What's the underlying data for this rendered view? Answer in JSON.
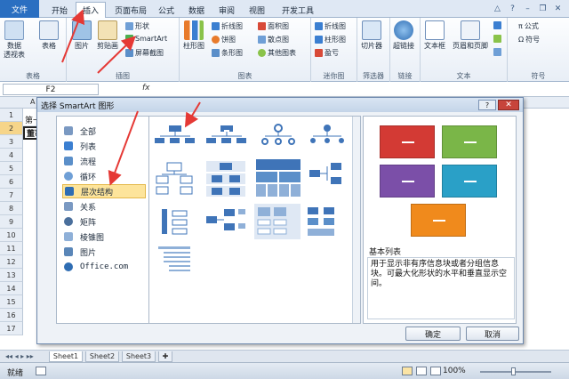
{
  "ribbon_tabs": {
    "file": "文件",
    "home": "开始",
    "insert": "插入",
    "page_layout": "页面布局",
    "formulas": "公式",
    "data": "数据",
    "review": "审阅",
    "view": "视图",
    "developer": "开发工具"
  },
  "ribbon": {
    "tables": {
      "pivot": "数据\n透视表",
      "table": "表格",
      "group": "表格"
    },
    "illustrations": {
      "picture": "图片",
      "clipart": "剪贴画",
      "shapes": "形状",
      "smartart": "SmartArt",
      "screenshot": "屏幕截图",
      "group": "插图"
    },
    "charts": {
      "column": "柱形图",
      "line": "折线图",
      "pie": "饼图",
      "bar": "条形图",
      "area": "面积图",
      "scatter": "散点图",
      "other": "其他图表",
      "group": "图表"
    },
    "sparklines": {
      "line": "折线图",
      "column": "柱形图",
      "winloss": "盈亏",
      "group": "迷你图"
    },
    "filter": {
      "slicer": "切片器",
      "group": "筛选器"
    },
    "links": {
      "hyperlink": "超链接",
      "group": "链接"
    },
    "text": {
      "textbox": "文本框",
      "header_footer": "页眉和页脚",
      "group": "文本"
    },
    "symbols": {
      "formula": "公式",
      "symbol": "符号",
      "group": "符号"
    }
  },
  "formula_bar": {
    "name_box": "F2",
    "fx": "fx"
  },
  "sheet": {
    "col_a": "A",
    "rows": [
      "1",
      "2",
      "3",
      "4",
      "5",
      "6",
      "7",
      "8",
      "9",
      "10",
      "11",
      "12",
      "13",
      "14",
      "15",
      "16",
      "17"
    ],
    "cell_a1": "第一",
    "cell_a2": "董事"
  },
  "dialog": {
    "title": "选择 SmartArt 图形",
    "help": "?",
    "close": "✕",
    "categories": [
      "全部",
      "列表",
      "流程",
      "循环",
      "层次结构",
      "关系",
      "矩阵",
      "棱锥图",
      "图片",
      "Office.com"
    ],
    "selected_category": "层次结构",
    "preview_title": "基本列表",
    "preview_desc": "用于显示非有序信息块或者分组信息块。可最大化形状的水平和垂直显示空间。",
    "ok": "确定",
    "cancel": "取消"
  },
  "sheet_tabs": [
    "Sheet1",
    "Sheet2",
    "Sheet3"
  ],
  "status": {
    "ready": "就绪",
    "zoom": "100%"
  },
  "colors": {
    "accent": "#2a6fc1",
    "annotation": "#e53935",
    "preview_red": "#d33a34",
    "preview_green": "#7ab648",
    "preview_purple": "#7b4fa8",
    "preview_orange": "#f08a1c"
  }
}
